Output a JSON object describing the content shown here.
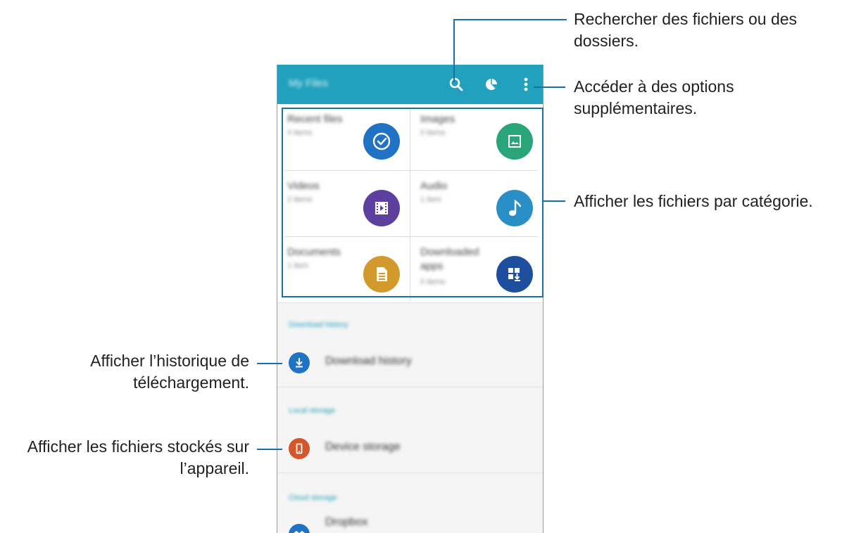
{
  "annotations": {
    "search_line1": "Rechercher des fichiers ou des",
    "search_line2": "dossiers.",
    "options_line1": "Accéder à des options",
    "options_line2": "supplémentaires.",
    "category": "Afficher les fichiers par catégorie.",
    "history_line1": "Afficher l’historique de",
    "history_line2": "téléchargement.",
    "storage_line1": "Afficher les fichiers stockés sur",
    "storage_line2": "l’appareil."
  },
  "app": {
    "title": "My Files",
    "icons": [
      "search-icon",
      "storage-usage-icon",
      "more-options-icon"
    ]
  },
  "categories": [
    {
      "label": "Recent files",
      "count": "4 items",
      "icon": "clock-icon",
      "color": "#1f72c4"
    },
    {
      "label": "Images",
      "count": "0 items",
      "icon": "image-icon",
      "color": "#2aa57a"
    },
    {
      "label": "Videos",
      "count": "2 items",
      "icon": "video-icon",
      "color": "#5d3f9f"
    },
    {
      "label": "Audio",
      "count": "1 item",
      "icon": "music-note-icon",
      "color": "#2a8fc7"
    },
    {
      "label": "Documents",
      "count": "1 item",
      "icon": "document-icon",
      "color": "#d29a2c"
    },
    {
      "label": "Downloaded apps",
      "count": "0 items",
      "icon": "downloaded-apps-icon",
      "color": "#1e4f9e"
    }
  ],
  "sections": {
    "download_header": "Download history",
    "download_row": "Download history",
    "local_header": "Local storage",
    "device_row": "Device storage",
    "cloud_header": "Cloud storage",
    "cloud_row": "Dropbox"
  },
  "colors": {
    "appbar": "#21a1bd",
    "callout": "#1b6fa6",
    "download_icon": "#1f72c4",
    "device_icon": "#d3572a",
    "cloud_icon": "#1f72c4"
  }
}
